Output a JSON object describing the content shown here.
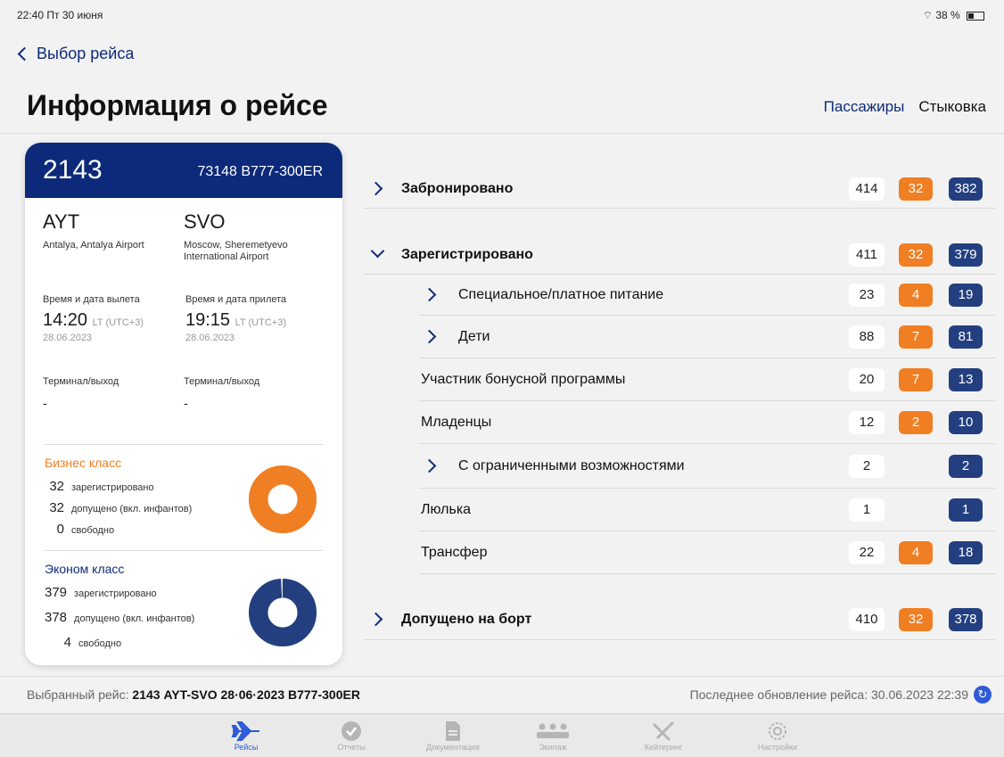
{
  "status": {
    "time": "22:40  Пт 30 июня",
    "battery": "38 %"
  },
  "nav": {
    "back_label": "Выбор рейса"
  },
  "page": {
    "title": "Информация о рейсе"
  },
  "tabs": [
    {
      "label": "Пассажиры"
    },
    {
      "label": "Стыковка"
    }
  ],
  "flight": {
    "number": "2143",
    "aircraft": "73148 B777-300ER",
    "origin": {
      "code": "AYT",
      "name": "Antalya, Antalya Airport"
    },
    "destination": {
      "code": "SVO",
      "name": "Moscow, Sheremetyevo International Airport"
    },
    "departure": {
      "label": "Время и дата вылета",
      "time": "14:20",
      "tz": "LT (UTC+3)",
      "date": "28.06.2023"
    },
    "arrival": {
      "label": "Время и дата прилета",
      "time": "19:15",
      "tz": "LT (UTC+3)",
      "date": "28.06.2023"
    },
    "terminal_dep": {
      "label": "Терминал/выход",
      "value": "-"
    },
    "terminal_arr": {
      "label": "Терминал/выход",
      "value": "-"
    }
  },
  "business": {
    "title": "Бизнес класс",
    "title_color": "#f07e22",
    "rows": [
      {
        "num": "32",
        "label": "зарегистрировано"
      },
      {
        "num": "32",
        "label": "допущено (вкл. инфантов)"
      },
      {
        "num": "0",
        "label": "свободно"
      }
    ],
    "occupied_fraction": 1.0
  },
  "economy": {
    "title": "Эконом класс",
    "title_color": "#0d2a7a",
    "rows": [
      {
        "num": "379",
        "label": "зарегистрировано"
      },
      {
        "num": "378",
        "label": "допущено (вкл. инфантов)"
      },
      {
        "num": "4",
        "label": "свободно"
      }
    ],
    "occupied_fraction": 0.99
  },
  "pax_rows": [
    {
      "label": "Забронировано",
      "total": "414",
      "business": "32",
      "economy": "382"
    },
    {
      "label": "Зарегистрировано",
      "total": "411",
      "business": "32",
      "economy": "379"
    },
    {
      "label": "Специальное/платное питание",
      "total": "23",
      "business": "4",
      "economy": "19"
    },
    {
      "label": "Дети",
      "total": "88",
      "business": "7",
      "economy": "81"
    },
    {
      "label": "Участник бонусной программы",
      "total": "20",
      "business": "7",
      "economy": "13"
    },
    {
      "label": "Младенцы",
      "total": "12",
      "business": "2",
      "economy": "10"
    },
    {
      "label": "С ограниченными возможностями",
      "total": "2",
      "business": "",
      "economy": "2"
    },
    {
      "label": "Люлька",
      "total": "1",
      "business": "",
      "economy": "1"
    },
    {
      "label": "Трансфер",
      "total": "22",
      "business": "4",
      "economy": "18"
    },
    {
      "label": "Допущено на борт",
      "total": "410",
      "business": "32",
      "economy": "378"
    }
  ],
  "footer": {
    "selected_label": "Выбранный рейс:",
    "selected_value": "2143 AYT-SVO 28·06·2023 B777-300ER",
    "updated": "Последнее обновление рейса: 30.06.2023 22:39"
  },
  "tabbar": [
    {
      "label": "Рейсы",
      "icon": "plane-icon"
    },
    {
      "label": "Отчеты",
      "icon": "check-icon"
    },
    {
      "label": "Документация",
      "icon": "document-icon"
    },
    {
      "label": "Экипаж",
      "icon": "crew-icon"
    },
    {
      "label": "Кейтеринг",
      "icon": "catering-icon"
    },
    {
      "label": "Настройки",
      "icon": "gear-icon"
    }
  ],
  "colors": {
    "brand": "#0d2a7a",
    "business": "#f07e22",
    "economy": "#233f80",
    "accent": "#2f5bd8"
  }
}
